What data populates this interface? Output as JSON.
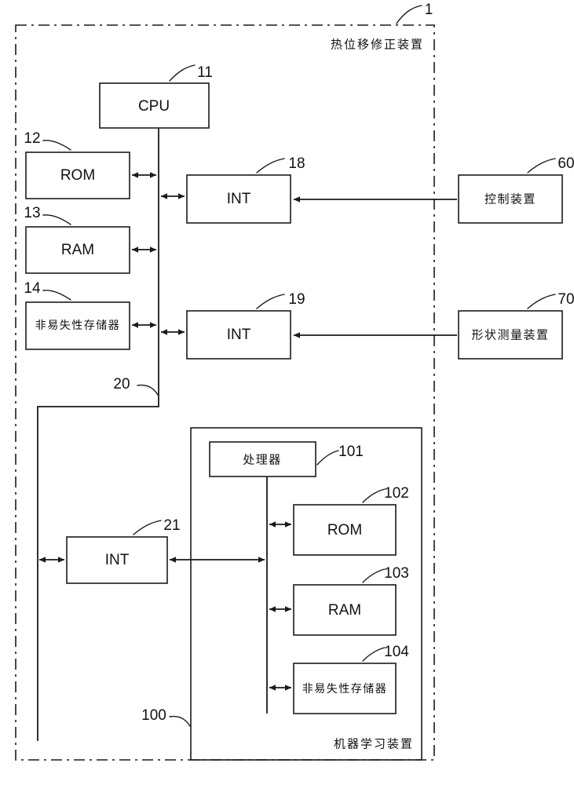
{
  "figure": {
    "outer": {
      "ref": "1",
      "caption": "热位移修正装置"
    },
    "ml_group": {
      "ref": "100",
      "caption": "机器学习装置"
    },
    "bus_main": {
      "ref": "20"
    }
  },
  "blocks": {
    "cpu": {
      "label": "CPU",
      "ref": "11"
    },
    "rom": {
      "label": "ROM",
      "ref": "12"
    },
    "ram": {
      "label": "RAM",
      "ref": "13"
    },
    "nvram": {
      "label": "非易失性存储器",
      "ref": "14"
    },
    "int18": {
      "label": "INT",
      "ref": "18"
    },
    "int19": {
      "label": "INT",
      "ref": "19"
    },
    "int21": {
      "label": "INT",
      "ref": "21"
    },
    "control": {
      "label": "控制装置",
      "ref": "60"
    },
    "shape": {
      "label": "形状测量装置",
      "ref": "70"
    },
    "processor": {
      "label": "处理器",
      "ref": "101"
    },
    "ml_rom": {
      "label": "ROM",
      "ref": "102"
    },
    "ml_ram": {
      "label": "RAM",
      "ref": "103"
    },
    "ml_nvram": {
      "label": "非易失性存储器",
      "ref": "104"
    }
  },
  "colors": {
    "line": "#1a1a1a",
    "background": "#ffffff",
    "text": "#111111"
  }
}
